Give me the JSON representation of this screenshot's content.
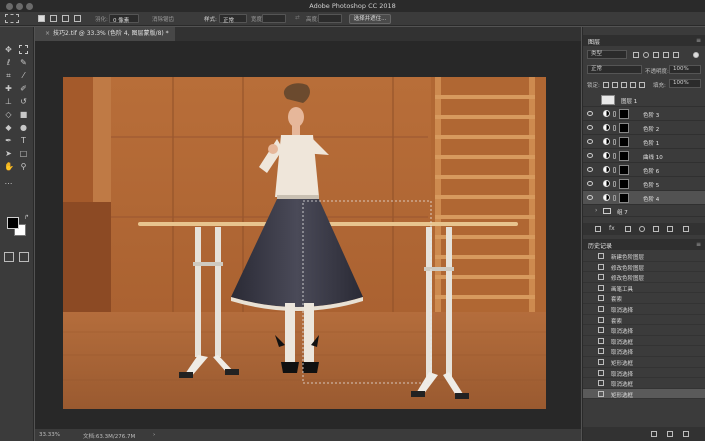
{
  "app_title": "Adobe Photoshop CC 2018",
  "options_bar": {
    "feather_label": "羽化:",
    "feather_value": "0 像素",
    "antialias_label": "消除锯齿",
    "style_label": "样式:",
    "style_value": "正常",
    "width_label": "宽度:",
    "height_label": "高度:",
    "select_mask_button": "选择并遮住..."
  },
  "document_tab": {
    "title": "技巧2.tif @ 33.3% (色阶 4, 图层蒙版/8) *"
  },
  "status_bar": {
    "zoom": "33.33%",
    "doc_info": "文档:63.3M/276.7M",
    "arrow": "›"
  },
  "layers_panel": {
    "title": "图层",
    "menu_glyph": "≡",
    "filter_value": "类型",
    "blend_mode": "正常",
    "opacity_label": "不透明度:",
    "opacity_value": "100%",
    "lock_label": "锁定:",
    "fill_label": "填充:",
    "fill_value": "100%",
    "layers": [
      {
        "name": "图层 1"
      },
      {
        "name": "色阶 3"
      },
      {
        "name": "色阶 2"
      },
      {
        "name": "色阶 1"
      },
      {
        "name": "曲线 10"
      },
      {
        "name": "色阶 6"
      },
      {
        "name": "色阶 5"
      },
      {
        "name": "色阶 4"
      },
      {
        "name": "组 7"
      }
    ],
    "footer_glyph": "fx"
  },
  "history_panel": {
    "title": "历史记录",
    "menu_glyph": "≡",
    "items": [
      {
        "label": "新建色阶图层"
      },
      {
        "label": "修改色阶图层"
      },
      {
        "label": "修改色阶图层"
      },
      {
        "label": "画笔工具"
      },
      {
        "label": "套索"
      },
      {
        "label": "取消选择"
      },
      {
        "label": "套索"
      },
      {
        "label": "取消选择"
      },
      {
        "label": "取消选框"
      },
      {
        "label": "取消选择"
      },
      {
        "label": "矩形选框"
      },
      {
        "label": "取消选择"
      },
      {
        "label": "取消选框"
      },
      {
        "label": "矩形选框"
      }
    ]
  },
  "colors": {
    "foreground": "#000000",
    "background": "#ffffff"
  }
}
